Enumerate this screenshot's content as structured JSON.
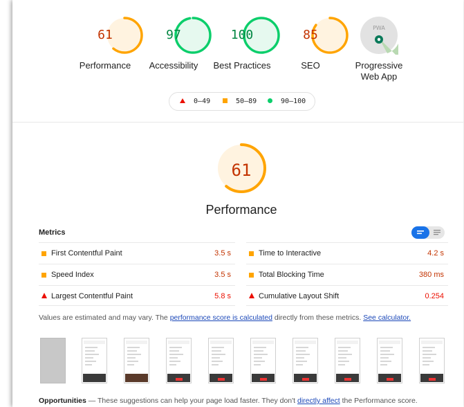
{
  "summary": {
    "gauges": [
      {
        "score": "61",
        "label": "Performance",
        "status": "average",
        "fraction": 0.61
      },
      {
        "score": "97",
        "label": "Accessibility",
        "status": "pass",
        "fraction": 0.97
      },
      {
        "score": "100",
        "label": "Best Practices",
        "status": "pass",
        "fraction": 1.0
      },
      {
        "score": "85",
        "label": "SEO",
        "status": "average",
        "fraction": 0.85
      }
    ],
    "pwa": {
      "label_line1": "Progressive",
      "label_line2": "Web App",
      "badge_text": "PWA"
    }
  },
  "legend": {
    "fail": "0–49",
    "average": "50–89",
    "pass": "90–100"
  },
  "performance": {
    "score": "61",
    "fraction": 0.61,
    "title": "Performance"
  },
  "metrics": {
    "heading": "Metrics",
    "left": [
      {
        "name": "First Contentful Paint",
        "value": "3.5 s",
        "status": "average"
      },
      {
        "name": "Speed Index",
        "value": "3.5 s",
        "status": "average"
      },
      {
        "name": "Largest Contentful Paint",
        "value": "5.8 s",
        "status": "fail"
      }
    ],
    "right": [
      {
        "name": "Time to Interactive",
        "value": "4.2 s",
        "status": "average"
      },
      {
        "name": "Total Blocking Time",
        "value": "380 ms",
        "status": "average"
      },
      {
        "name": "Cumulative Layout Shift",
        "value": "0.254",
        "status": "fail"
      }
    ]
  },
  "note": {
    "prefix": "Values are estimated and may vary. The ",
    "link1": "performance score is calculated",
    "middle": " directly from these metrics. ",
    "link2": "See calculator."
  },
  "opportunities": {
    "heading": "Opportunities",
    "text_before": " — These suggestions can help your page load faster. They don't ",
    "link": "directly affect",
    "text_after": " the Performance score."
  },
  "colors": {
    "fail": "#eb0f00",
    "average": "#ffa400",
    "pass": "#0cce6b",
    "link": "#1a47b8",
    "toggle_active": "#1a73e8"
  }
}
